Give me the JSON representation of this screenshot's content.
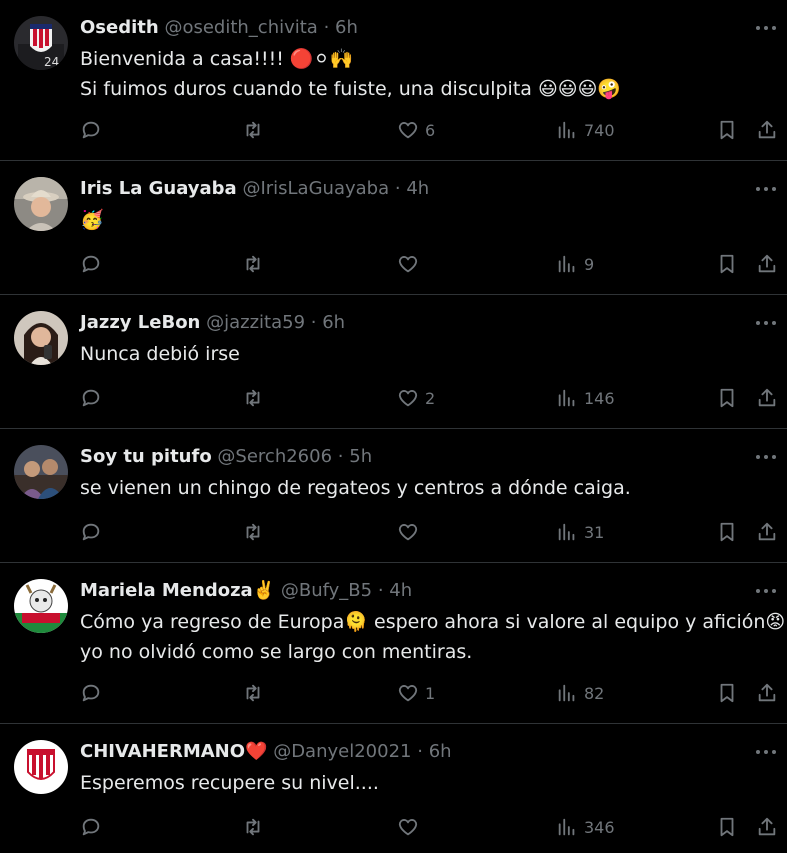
{
  "colors": {
    "background": "#000000",
    "text": "#e7e9ea",
    "muted": "#71767b",
    "divider": "#2f3336"
  },
  "tweets": [
    {
      "name": "Osedith",
      "handle": "@osedith_chivita",
      "time": "6h",
      "lines": [
        "Bienvenida a casa!!!! 🔴⚪🙌",
        "Si fuimos duros cuando te fuiste, una disculpita 😃😃😃🤪"
      ],
      "replies": "",
      "retweets": "",
      "likes": "6",
      "views": "740",
      "avatar_icon": "chivas-crest-avatar"
    },
    {
      "name": "Iris La Guayaba",
      "handle": "@IrisLaGuayaba",
      "time": "4h",
      "lines": [
        "🥳"
      ],
      "replies": "",
      "retweets": "",
      "likes": "",
      "views": "9",
      "avatar_icon": "person-hat-avatar"
    },
    {
      "name": "Jazzy LeBon",
      "handle": "@jazzita59",
      "time": "6h",
      "lines": [
        "Nunca debió irse"
      ],
      "replies": "",
      "retweets": "",
      "likes": "2",
      "views": "146",
      "avatar_icon": "person-selfie-avatar"
    },
    {
      "name": "Soy tu pitufo",
      "handle": "@Serch2606",
      "time": "5h",
      "lines": [
        "se vienen un chingo de regateos y centros a dónde caiga."
      ],
      "replies": "",
      "retweets": "",
      "likes": "",
      "views": "31",
      "avatar_icon": "group-photo-avatar"
    },
    {
      "name": "Mariela Mendoza✌️",
      "handle": "@Bufy_B5",
      "time": "4h",
      "lines": [
        "Cómo ya regreso de Europa🫠 espero ahora si valore al equipo y afición😡",
        "yo no olvidó como se largo con mentiras."
      ],
      "replies": "",
      "retweets": "",
      "likes": "1",
      "views": "82",
      "avatar_icon": "goat-mascot-avatar"
    },
    {
      "name": "CHIVAHERMANO❤️",
      "handle": "@Danyel20021",
      "time": "6h",
      "lines": [
        "Esperemos recupere su nivel...."
      ],
      "replies": "",
      "retweets": "",
      "likes": "",
      "views": "346",
      "avatar_icon": "chivas-logo-avatar"
    }
  ]
}
